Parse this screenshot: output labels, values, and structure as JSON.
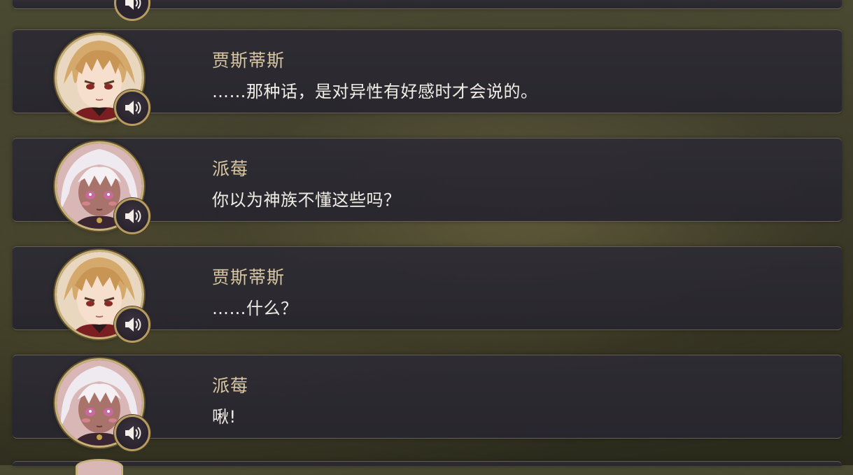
{
  "log": {
    "entries": [
      {
        "speaker": "贾斯蒂斯",
        "text": "……那种话，是对异性有好感时才会说的。",
        "avatar": "jastice-portrait",
        "voice_icon": "speaker-volume-icon"
      },
      {
        "speaker": "派莓",
        "text": "你以为神族不懂这些吗？",
        "avatar": "paimei-portrait",
        "voice_icon": "speaker-volume-icon"
      },
      {
        "speaker": "贾斯蒂斯",
        "text": "……什么？",
        "avatar": "jastice-portrait",
        "voice_icon": "speaker-volume-icon"
      },
      {
        "speaker": "派莓",
        "text": "啾!",
        "avatar": "paimei-portrait",
        "voice_icon": "speaker-volume-icon"
      }
    ]
  },
  "colors": {
    "speaker_name": "#d8c7a0",
    "dialogue_text": "#f1ede6",
    "entry_bg": "#2e2c34",
    "frame_gold": "#c8b27a"
  }
}
